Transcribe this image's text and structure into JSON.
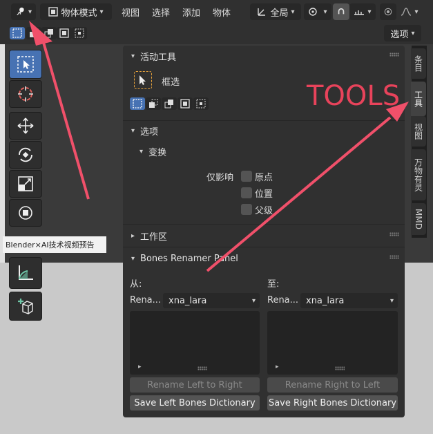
{
  "header": {
    "editor_type_icon": "object-data-icon",
    "mode_label": "物体模式",
    "menus": [
      "视图",
      "选择",
      "添加",
      "物体"
    ],
    "orientation_label": "全局"
  },
  "subbar": {
    "options_label": "选项"
  },
  "tooltip": {
    "text": "Blender×AI技术视频预告"
  },
  "annotation": {
    "text": "TOOLS",
    "color": "#e8435b"
  },
  "n_panel_tabs": [
    "条目",
    "工具",
    "视图",
    "万物有灵",
    "MMD"
  ],
  "active_tool_panel": {
    "title": "活动工具",
    "tool_name": "框选"
  },
  "options_panel": {
    "title": "选项",
    "transform_title": "变换",
    "affect_only_label": "仅影响",
    "checkboxes": [
      "原点",
      "位置",
      "父级"
    ]
  },
  "workspace_panel": {
    "title": "工作区"
  },
  "bones_renamer": {
    "title": "Bones Renamer Panel",
    "from_label": "从:",
    "to_label": "至:",
    "left_row_label": "Rena...",
    "right_row_label": "Rena...",
    "left_dropdown_value": "xna_lara",
    "right_dropdown_value": "xna_lara",
    "rename_left_to_right": "Rename Left to Right",
    "rename_right_to_left": "Rename Right to Left",
    "save_left": "Save Left Bones Dictionary",
    "save_right": "Save Right Bones Dictionary"
  },
  "colors": {
    "accent_blue": "#4772b3",
    "arrow_red": "#f0506a",
    "tool_highlight": "#e8a33b"
  }
}
